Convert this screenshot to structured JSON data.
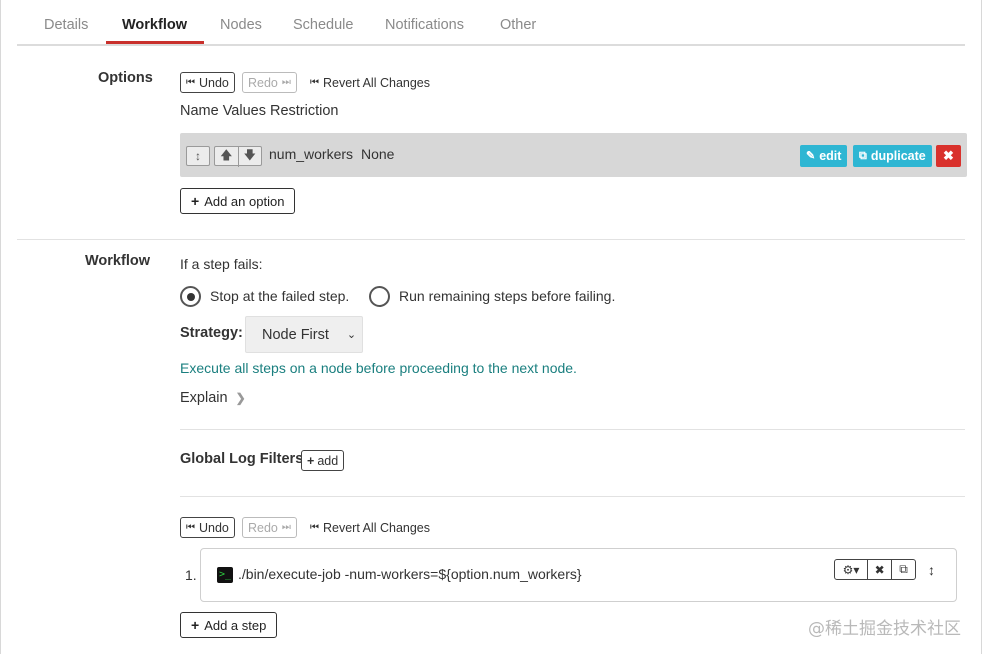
{
  "tabs": [
    "Details",
    "Workflow",
    "Nodes",
    "Schedule",
    "Notifications",
    "Other"
  ],
  "active_tab": "Workflow",
  "options_section": {
    "label": "Options",
    "undo_label": "Undo",
    "redo_label": "Redo",
    "revert_label": "Revert All Changes",
    "header": "Name Values Restriction",
    "option_name": "num_workers",
    "option_values": "None",
    "edit_label": "edit",
    "duplicate_label": "duplicate",
    "delete_label": "✖",
    "add_option_label": "Add an option"
  },
  "workflow_section": {
    "label": "Workflow",
    "if_fails_label": "If a step fails:",
    "radio_stop_label": "Stop at the failed step.",
    "radio_run_label": "Run remaining steps before failing.",
    "selected_failure_mode": "stop",
    "strategy_label": "Strategy:",
    "strategy_value": "Node First",
    "strategy_description": "Execute all steps on a node before proceeding to the next node.",
    "explain_label": "Explain",
    "log_filters_label": "Global Log Filters",
    "add_filter_label": "add",
    "undo_label": "Undo",
    "redo_label": "Redo",
    "revert_label": "Revert All Changes",
    "steps": [
      {
        "number": "1.",
        "command": "./bin/execute-job -num-workers=${option.num_workers}"
      }
    ],
    "add_step_label": "Add a step"
  },
  "watermark": "@稀土掘金技术社区",
  "colors": {
    "accent_red": "#c9302c",
    "teal": "#2eb6d3",
    "description_teal": "#1a7f7f",
    "delete_red": "#d9312c"
  }
}
